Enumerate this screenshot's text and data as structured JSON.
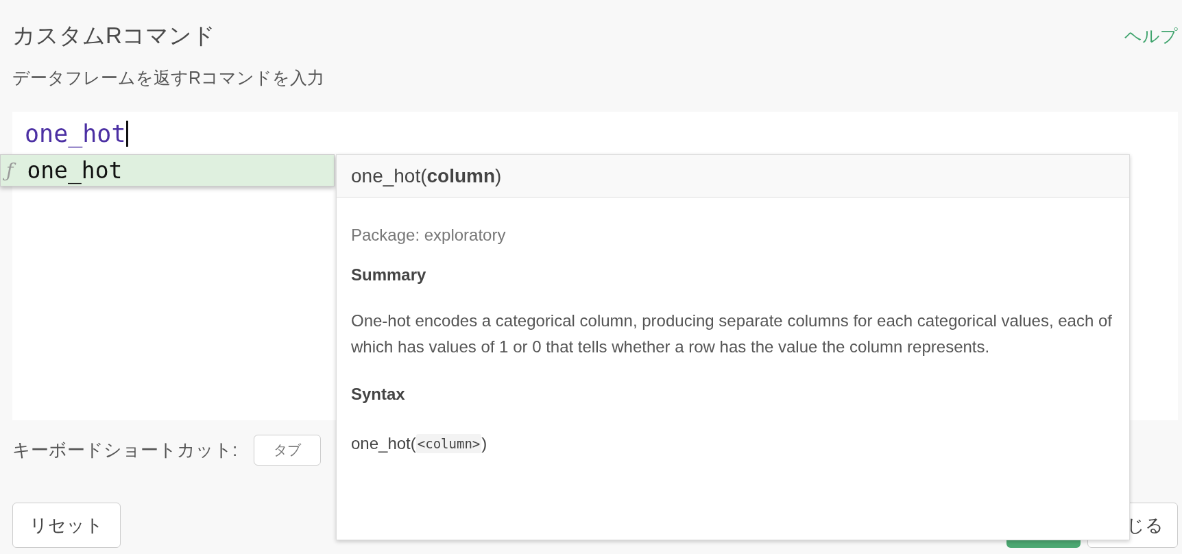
{
  "dialog": {
    "title": "カスタムRコマンド",
    "help_link": "ヘルプ",
    "subtitle": "データフレームを返すRコマンドを入力"
  },
  "editor": {
    "value": "one_hot"
  },
  "autocomplete": {
    "items": [
      {
        "icon": "ƒ",
        "label": "one_hot",
        "selected": true
      }
    ]
  },
  "doc_popup": {
    "signature": "one_hot(**column**)",
    "package": "Package: exploratory",
    "summary_heading": "Summary",
    "summary": "One-hot encodes a categorical column, producing separate columns for each categorical values, each of which has values of 1 or 0 that tells whether a row has the value the column represents.",
    "syntax_heading": "Syntax",
    "syntax": {
      "name": "one_hot(",
      "argument": "<column>",
      "close": ")"
    }
  },
  "shortcut": {
    "label": "キーボードショートカット:",
    "key": "タブ"
  },
  "buttons": {
    "reset": "リセット",
    "close": "じる"
  }
}
